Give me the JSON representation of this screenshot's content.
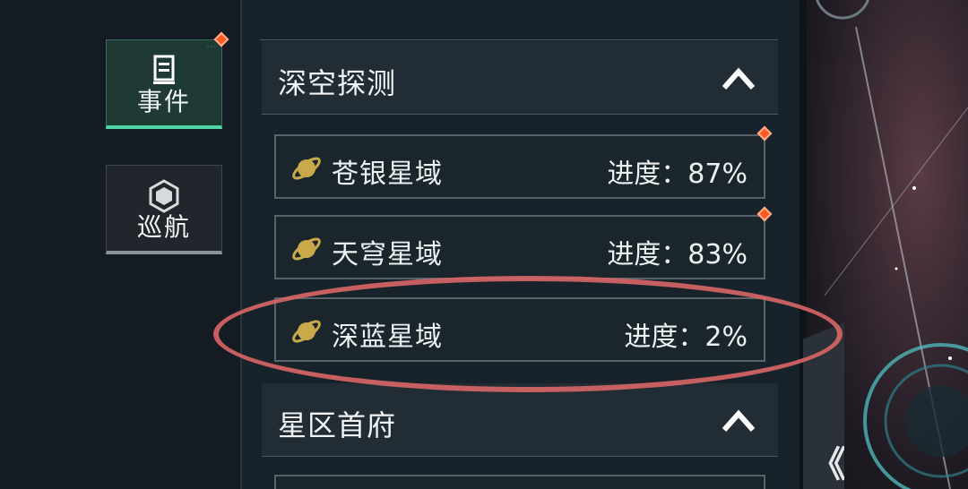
{
  "left_nav": {
    "tabs": [
      {
        "label": "事件",
        "icon": "document-icon",
        "active": true,
        "badge": true
      },
      {
        "label": "巡航",
        "icon": "hexagon-icon",
        "active": false,
        "badge": false
      }
    ]
  },
  "sections": [
    {
      "title": "深空探测",
      "expanded": true,
      "items": [
        {
          "name": "苍银星域",
          "progress": "进度：87%",
          "badge": true
        },
        {
          "name": "天穹星域",
          "progress": "进度：83%",
          "badge": true
        },
        {
          "name": "深蓝星域",
          "progress": "进度：2%",
          "badge": false
        }
      ]
    },
    {
      "title": "星区首府",
      "expanded": true,
      "items": []
    }
  ],
  "side_handle": {
    "label": "《"
  },
  "colors": {
    "accent_green": "#4fd6a8",
    "badge_orange": "#ff5a22",
    "planet_gold": "#c9a94a",
    "highlight_red": "#d96666"
  }
}
